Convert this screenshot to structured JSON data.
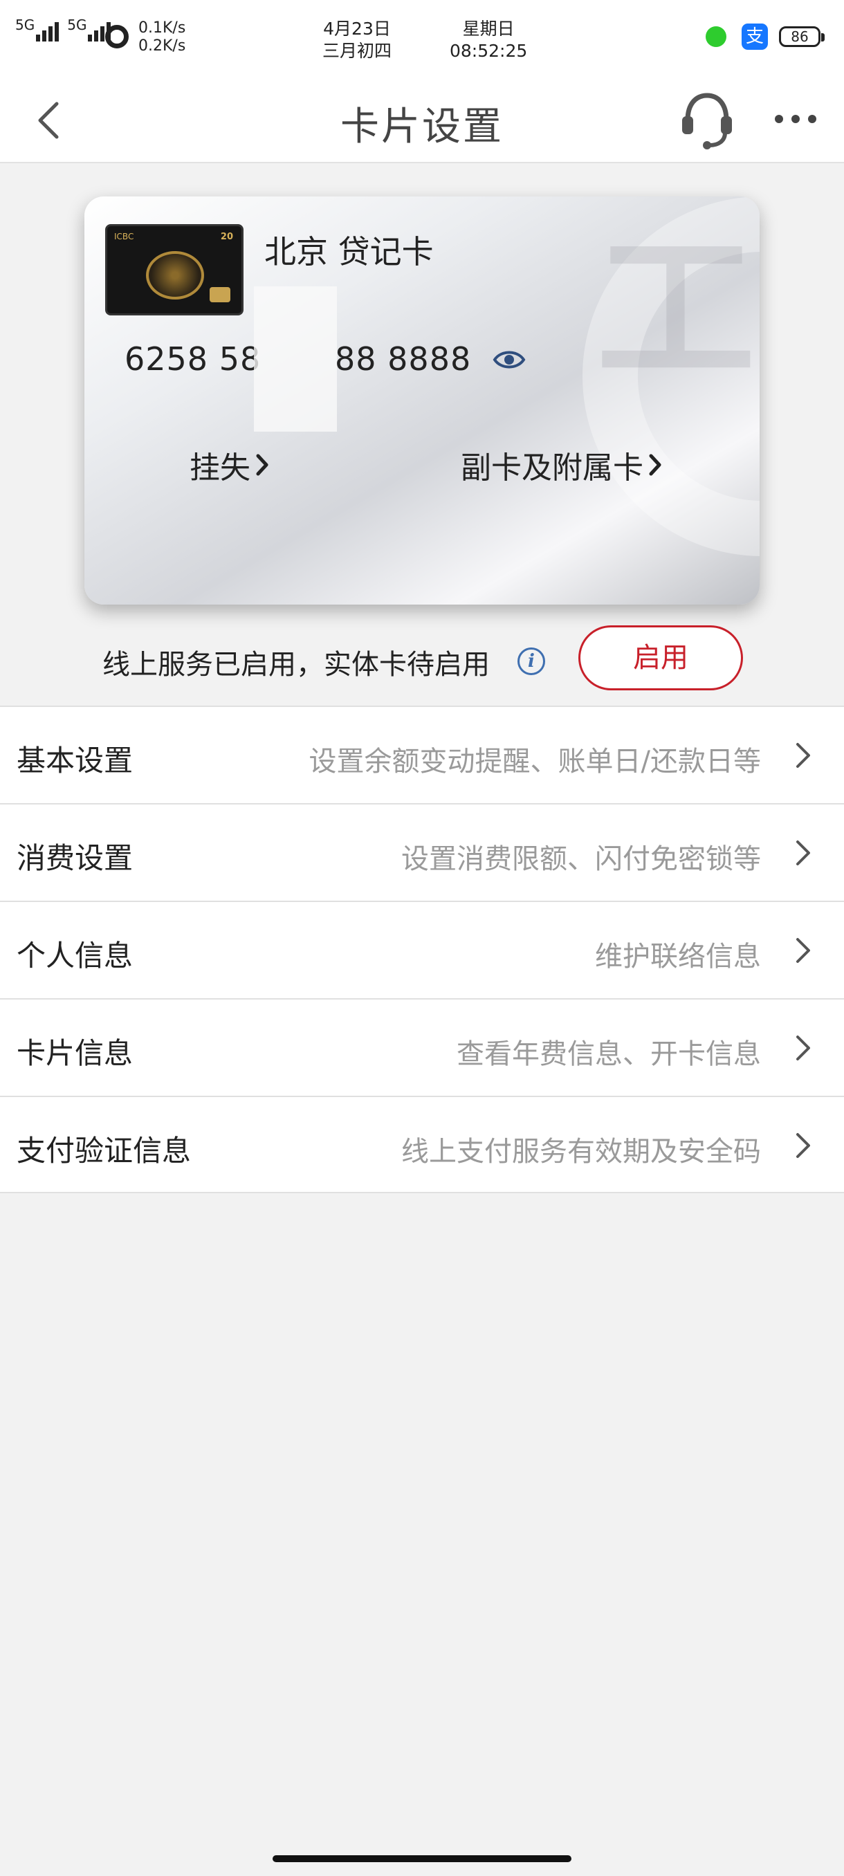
{
  "status_bar": {
    "network_1": "5G",
    "network_2": "5G",
    "speed_up": "0.1K/s",
    "speed_down": "0.2K/s",
    "date": "4月23日",
    "lunar_date": "三月初四",
    "weekday": "星期日",
    "time": "08:52:25",
    "alipay_icon_char": "支",
    "battery": "86"
  },
  "navbar": {
    "title": "卡片设置"
  },
  "card": {
    "bank_name": "北京 贷记卡",
    "number_prefix": "6258 58",
    "number_suffix": "88 8888",
    "thumb_logo": "ICBC",
    "thumb_badge": "20",
    "report_loss_label": "挂失",
    "supplementary_label": "副卡及附属卡"
  },
  "activation": {
    "status_text": "线上服务已启用，实体卡待启用",
    "info_icon_char": "i",
    "activate_label": "启用"
  },
  "menu": [
    {
      "title": "基本设置",
      "desc": "设置余额变动提醒、账单日/还款日等"
    },
    {
      "title": "消费设置",
      "desc": "设置消费限额、闪付免密锁等"
    },
    {
      "title": "个人信息",
      "desc": "维护联络信息"
    },
    {
      "title": "卡片信息",
      "desc": "查看年费信息、开卡信息"
    },
    {
      "title": "支付验证信息",
      "desc": "线上支付服务有效期及安全码"
    }
  ],
  "colors": {
    "accent_red": "#c8202a",
    "info_blue": "#3f6fb0",
    "alipay_blue": "#1677ff"
  }
}
